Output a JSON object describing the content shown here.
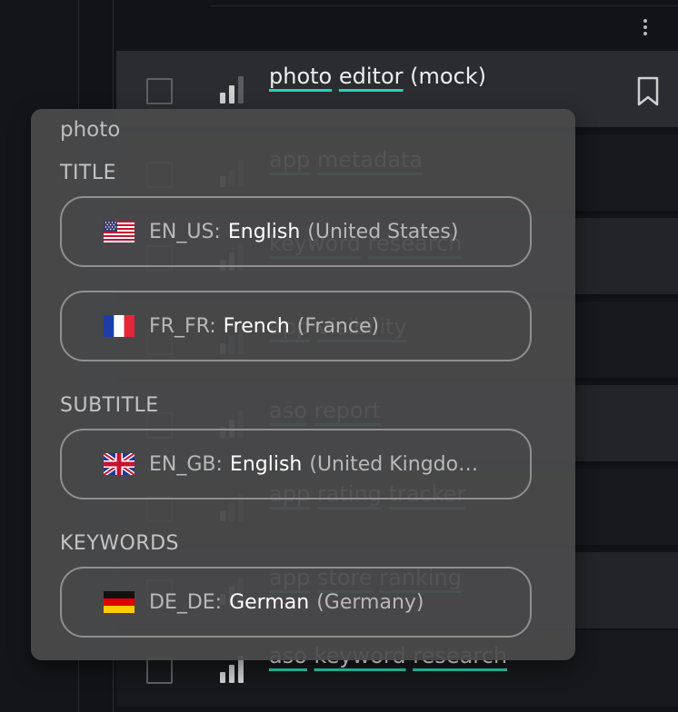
{
  "toolbar": {
    "more_icon": "more-vertical-icon"
  },
  "colors": {
    "underline_accent": "#27d3b4",
    "bar_strong": "#cfcfcf",
    "bar_faint": "#5a5c61"
  },
  "list": {
    "rows": [
      {
        "keywords": [
          "photo",
          "editor"
        ],
        "extra": "(mock)",
        "selected": true,
        "bookmarked": true
      },
      {
        "keywords": [
          "app",
          "metadata"
        ],
        "extra": ""
      },
      {
        "keywords": [
          "keyword",
          "research"
        ],
        "extra": ""
      },
      {
        "keywords": [
          "app",
          "visibility"
        ],
        "extra": ""
      },
      {
        "keywords": [
          "aso",
          "report"
        ],
        "extra": ""
      },
      {
        "keywords": [
          "app",
          "rating",
          "tracker"
        ],
        "extra": ""
      },
      {
        "keywords": [
          "app",
          "store",
          "ranking"
        ],
        "extra": ""
      },
      {
        "keywords": [
          "aso",
          "keyword",
          "research"
        ],
        "extra": ""
      }
    ]
  },
  "popover": {
    "query": "photo",
    "sections": [
      {
        "label": "TITLE",
        "locales": [
          {
            "flag": "us-flag-icon",
            "code": "EN_US:",
            "language": "English",
            "region": "(United States)"
          },
          {
            "flag": "fr-flag-icon",
            "code": "FR_FR:",
            "language": "French",
            "region": "(France)"
          }
        ]
      },
      {
        "label": "SUBTITLE",
        "locales": [
          {
            "flag": "gb-flag-icon",
            "code": "EN_GB:",
            "language": "English",
            "region": "(United Kingdo…"
          }
        ]
      },
      {
        "label": "KEYWORDS",
        "locales": [
          {
            "flag": "de-flag-icon",
            "code": "DE_DE:",
            "language": "German",
            "region": "(Germany)"
          }
        ]
      }
    ]
  }
}
